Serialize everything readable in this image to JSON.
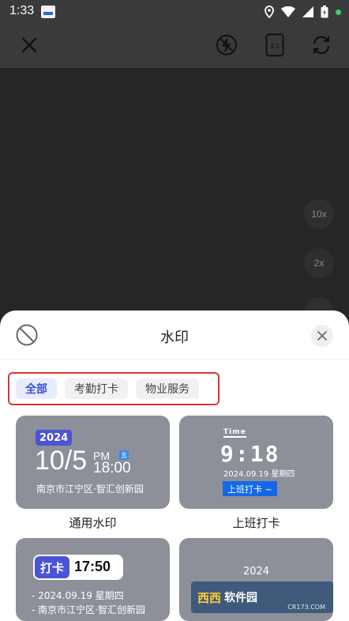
{
  "status_bar": {
    "time": "1:33"
  },
  "toolbar": {},
  "preview": {
    "zoom_levels": [
      "10x",
      "2x"
    ]
  },
  "sheet": {
    "title": "水印",
    "tabs": [
      {
        "label": "全部",
        "active": true
      },
      {
        "label": "考勤打卡",
        "active": false
      },
      {
        "label": "物业服务",
        "active": false
      }
    ],
    "cards": [
      {
        "label": "通用水印",
        "year": "2024",
        "date": "10/5",
        "ampm": "PM",
        "clock": "18:00",
        "weekday": "五",
        "address": "南京市江宁区·智汇创新园"
      },
      {
        "label": "上班打卡",
        "time_caption": "Time",
        "big_time": "9:18",
        "date_line": "2024.09.19 星期四",
        "action": "上班打卡 ~"
      },
      {
        "punch": "打卡",
        "time": "17:50",
        "line1": "- 2024.09.19 星期四",
        "line2": "- 南京市江宁区·智汇创新园"
      },
      {
        "year": "2024",
        "overlay_a": "西西",
        "overlay_b": "软件园",
        "overlay_url": "CR173.COM"
      }
    ]
  },
  "colors": {
    "accent": "#3b4fd8",
    "highlight_border": "#d5372e",
    "card_bg": "#8d9099",
    "action_blue": "#1468e8"
  }
}
